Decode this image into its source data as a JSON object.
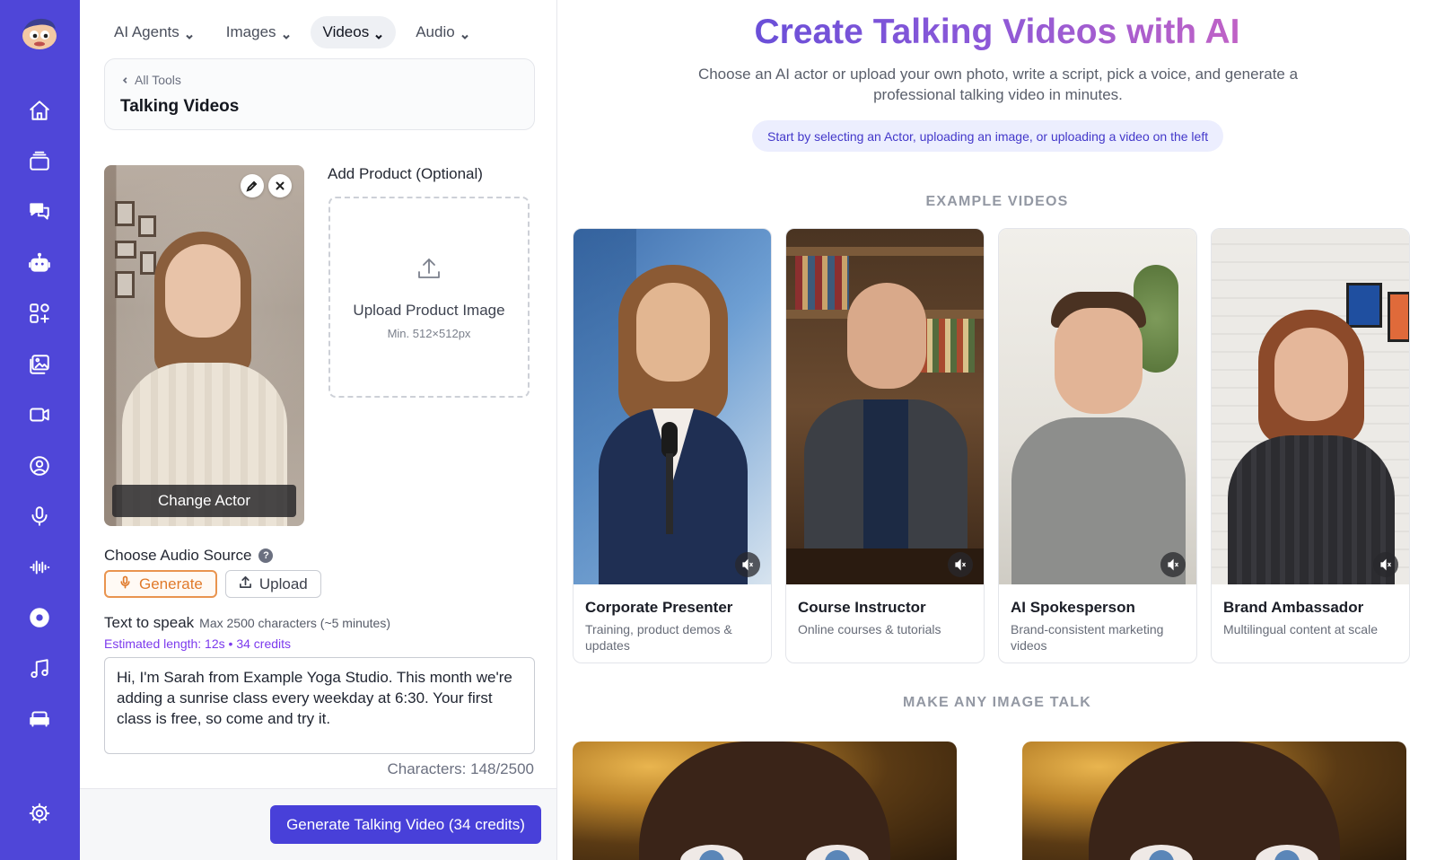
{
  "nav": {
    "tabs": [
      {
        "label": "AI Agents"
      },
      {
        "label": "Images"
      },
      {
        "label": "Videos"
      },
      {
        "label": "Audio"
      }
    ]
  },
  "breadcrumb": {
    "back": "All Tools",
    "title": "Talking Videos"
  },
  "actor": {
    "change_label": "Change Actor"
  },
  "product": {
    "label": "Add Product (Optional)",
    "upload_title": "Upload Product Image",
    "upload_hint": "Min. 512×512px"
  },
  "audio": {
    "label": "Choose Audio Source",
    "help": "?",
    "generate": "Generate",
    "upload": "Upload"
  },
  "tts": {
    "label": "Text to speak",
    "max": "Max 2500 characters (~5 minutes)",
    "estimate": "Estimated length: 12s • 34 credits",
    "text": "Hi, I'm Sarah from Example Yoga Studio. This month we're adding a sunrise class every weekday at 6:30. Your first class is free, so come and try it.",
    "chars": "Characters: 148/2500"
  },
  "generate_button": "Generate Talking Video (34 credits)",
  "hero": {
    "title": "Create Talking Videos with AI",
    "subtitle": "Choose an AI actor or upload your own photo, write a script, pick a voice, and generate a professional talking video in minutes.",
    "hint": "Start by selecting an Actor, uploading an image, or uploading a video on the left"
  },
  "examples": {
    "heading": "EXAMPLE VIDEOS",
    "cards": [
      {
        "title": "Corporate Presenter",
        "desc": "Training, product demos & updates"
      },
      {
        "title": "Course Instructor",
        "desc": "Online courses & tutorials"
      },
      {
        "title": "AI Spokesperson",
        "desc": "Brand-consistent marketing videos"
      },
      {
        "title": "Brand Ambassador",
        "desc": "Multilingual content at scale"
      }
    ]
  },
  "image_talk": {
    "heading": "MAKE ANY IMAGE TALK"
  },
  "colors": {
    "rail": "#4f46d8",
    "primary": "#4840d9",
    "accent_orange": "#e07a2b",
    "purple": "#7c3aed"
  },
  "icons": {
    "rail": [
      "app-logo-icon",
      "home-icon",
      "inbox-icon",
      "chat-icon",
      "robot-icon",
      "apps-icon",
      "gallery-icon",
      "video-icon",
      "user-circle-icon",
      "microphone-icon",
      "waveform-icon",
      "disc-icon",
      "music-icon",
      "sofa-icon",
      "settings-icon"
    ]
  }
}
